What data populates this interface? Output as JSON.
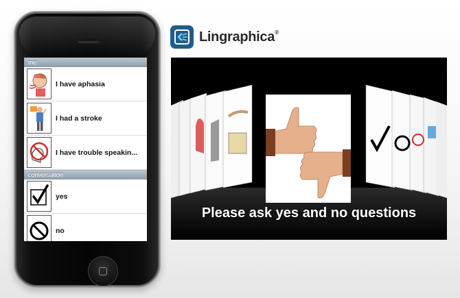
{
  "phone_app": {
    "sections": [
      {
        "header": "me",
        "items": [
          {
            "label": "I have aphasia",
            "icon": "aphasia-head-icon"
          },
          {
            "label": "I had a stroke",
            "icon": "stroke-person-icon"
          },
          {
            "label": "I have trouble speakin...",
            "icon": "no-speaking-icon"
          }
        ]
      },
      {
        "header": "conversation",
        "items": [
          {
            "label": "yes",
            "icon": "checkmark-icon"
          },
          {
            "label": "no",
            "icon": "prohibited-icon"
          }
        ]
      }
    ]
  },
  "logo": {
    "name": "Lingraphica",
    "mark": "®"
  },
  "banner": {
    "caption": "Please ask yes and no questions"
  }
}
